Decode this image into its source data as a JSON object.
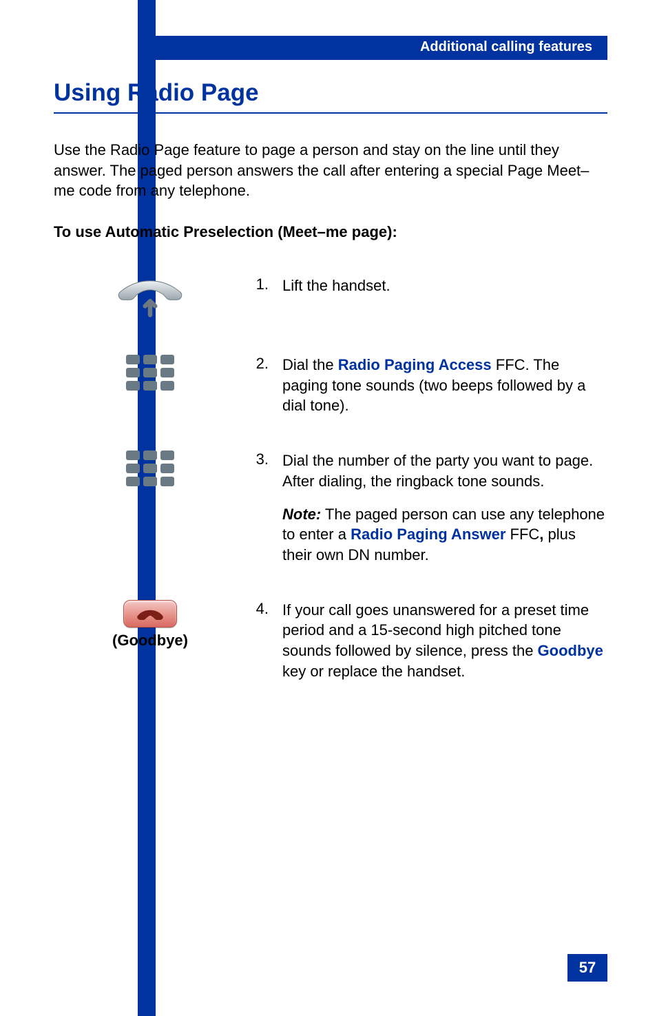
{
  "header": {
    "section_title": "Additional calling features"
  },
  "page": {
    "title": "Using Radio Page",
    "intro": "Use the Radio Page feature to page a person and stay on the line until they answer. The paged person answers the call after entering a special Page Meet–me code from any telephone.",
    "subhead": "To use Automatic Preselection (Meet–me page):",
    "number": "57"
  },
  "steps": [
    {
      "num": "1.",
      "icon": "handset-lift-icon",
      "caption": "",
      "segments": [
        {
          "text": "Lift the handset."
        }
      ]
    },
    {
      "num": "2.",
      "icon": "keypad-icon",
      "caption": "",
      "segments": [
        {
          "text": "Dial the "
        },
        {
          "text": "Radio Paging Access",
          "style": "term"
        },
        {
          "text": " FFC. The paging tone sounds (two beeps followed by a dial tone)."
        }
      ]
    },
    {
      "num": "3.",
      "icon": "keypad-icon",
      "caption": "",
      "segments": [
        {
          "text": "Dial the number of the party you want to page. After dialing, the ringback tone sounds."
        }
      ],
      "note_segments": [
        {
          "text": "Note:",
          "style": "ital"
        },
        {
          "text": " The paged person can use any telephone to enter a "
        },
        {
          "text": "Radio Paging Answer",
          "style": "term"
        },
        {
          "text": " FFC"
        },
        {
          "text": ",",
          "style": "bold"
        },
        {
          "text": " plus their own DN number."
        }
      ]
    },
    {
      "num": "4.",
      "icon": "goodbye-button-icon",
      "caption": "(Goodbye)",
      "segments": [
        {
          "text": "If your call goes unanswered for a preset time period and a 15-second high pitched tone sounds followed by silence, press the "
        },
        {
          "text": "Goodbye",
          "style": "term"
        },
        {
          "text": " key or replace the handset."
        }
      ]
    }
  ]
}
